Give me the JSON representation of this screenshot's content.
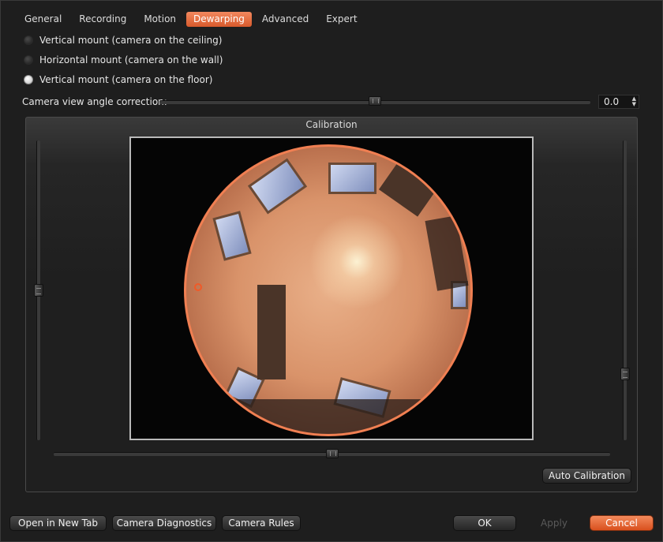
{
  "tabs": [
    {
      "label": "General",
      "active": false
    },
    {
      "label": "Recording",
      "active": false
    },
    {
      "label": "Motion",
      "active": false
    },
    {
      "label": "Dewarping",
      "active": true
    },
    {
      "label": "Advanced",
      "active": false
    },
    {
      "label": "Expert",
      "active": false
    }
  ],
  "mount_options": [
    {
      "label": "Vertical mount (camera on the ceiling)",
      "checked": false
    },
    {
      "label": "Horizontal mount (camera on the wall)",
      "checked": false
    },
    {
      "label": "Vertical mount (camera on the floor)",
      "checked": true
    }
  ],
  "angle_correction": {
    "label": "Camera view angle correction:",
    "value": "0.0",
    "slider_fraction": 0.5
  },
  "calibration": {
    "title": "Calibration",
    "auto_button": "Auto Calibration",
    "horizontal_slider_fraction": 0.5,
    "left_slider_fraction": 0.5,
    "right_slider_fraction": 0.78
  },
  "footer": {
    "open_new_tab": "Open in New Tab",
    "diagnostics": "Camera Diagnostics",
    "rules": "Camera Rules",
    "ok": "OK",
    "apply": "Apply",
    "cancel": "Cancel"
  },
  "colors": {
    "accent": "#e8683a",
    "background": "#1e1e1e"
  }
}
